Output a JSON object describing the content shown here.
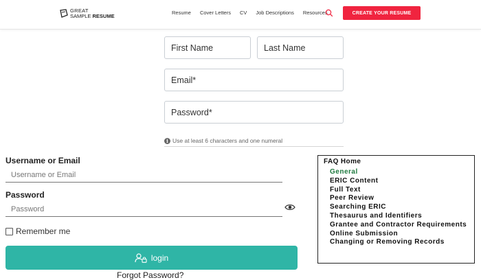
{
  "header": {
    "logo_line1": "GREAT",
    "logo_line2a": "SAMPLE ",
    "logo_line2b": "RESUME",
    "nav": [
      "Resume",
      "Cover Letters",
      "CV",
      "Job Descriptions",
      "Resources"
    ],
    "cta": "CREATE YOUR RESUME",
    "accent": "#f0243f"
  },
  "signup": {
    "first_name_placeholder": "First Name",
    "last_name_placeholder": "Last Name",
    "email_placeholder": "Email*",
    "password_placeholder": "Password*",
    "hint_icon": "i",
    "hint": "Use at least 6 characters and one numeral"
  },
  "login": {
    "username_label": "Username or Email",
    "username_placeholder": "Username or Email",
    "password_label": "Password",
    "password_placeholder": "Password",
    "remember_label": "Remember me",
    "login_button": "login",
    "forgot_link": "Forgot Password?",
    "button_color": "#2fb5a6"
  },
  "faq": {
    "title": "FAQ Home",
    "items": [
      "General",
      "ERIC Content",
      "Full Text",
      "Peer Review",
      "Searching ERIC",
      "Thesaurus and Identifiers",
      "Grantee and Contractor Requirements",
      "Online Submission",
      "Changing or Removing Records"
    ],
    "active_item": "General",
    "active_color": "#1f7a3f"
  }
}
